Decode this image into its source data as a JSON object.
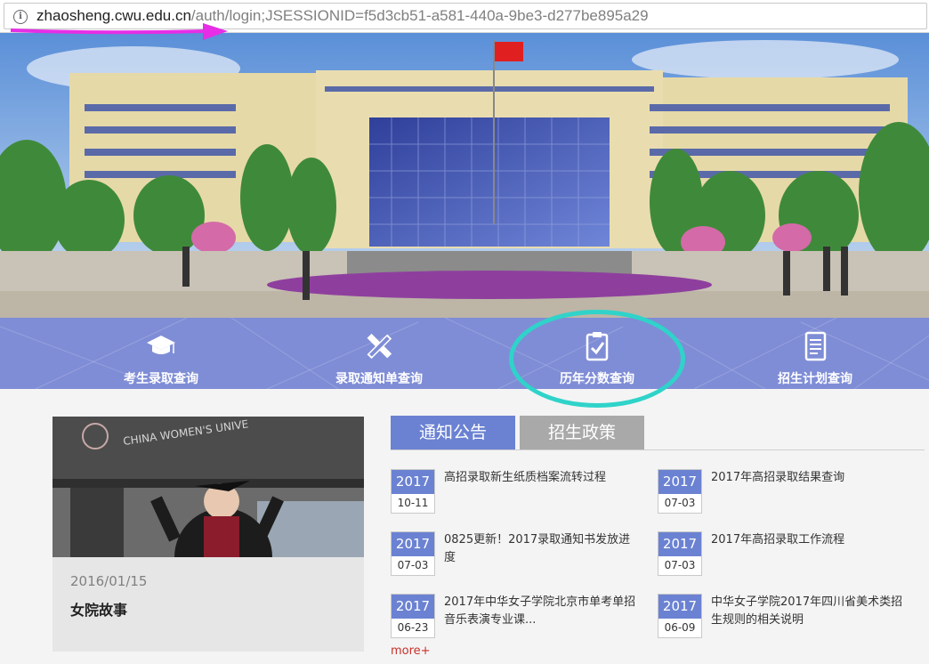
{
  "address_bar": {
    "host": "zhaosheng.cwu.edu.cn",
    "path": "/auth/login;JSESSIONID=f5d3cb51-a581-440a-9be3-d277be895a29",
    "info_icon": "info-icon"
  },
  "nav": {
    "items": [
      {
        "label": "考生录取查询",
        "icon": "graduation-cap-icon"
      },
      {
        "label": "录取通知单查询",
        "icon": "pencil-ruler-icon"
      },
      {
        "label": "历年分数查询",
        "icon": "clipboard-check-icon"
      },
      {
        "label": "招生计划查询",
        "icon": "document-icon"
      }
    ]
  },
  "feature": {
    "date": "2016/01/15",
    "title": "女院故事",
    "sign_text": "CHINA WOMEN'S UNIVE"
  },
  "tabs": {
    "active": "通知公告",
    "inactive": "招生政策"
  },
  "news": [
    {
      "year": "2017",
      "md": "10-11",
      "text": "高招录取新生纸质档案流转过程"
    },
    {
      "year": "2017",
      "md": "07-03",
      "text": "2017年高招录取结果查询"
    },
    {
      "year": "2017",
      "md": "07-03",
      "text": "0825更新！2017录取通知书发放进度"
    },
    {
      "year": "2017",
      "md": "07-03",
      "text": "2017年高招录取工作流程"
    },
    {
      "year": "2017",
      "md": "06-23",
      "text": "2017年中华女子学院北京市单考单招音乐表演专业课..."
    },
    {
      "year": "2017",
      "md": "06-09",
      "text": "中华女子学院2017年四川省美术类招生规则的相关说明"
    }
  ],
  "more_label": "more+",
  "colors": {
    "accent": "#6b82d2",
    "nav_bg": "#7f8dd6",
    "highlight_circle": "#2fd3c9",
    "annotation_arrow": "#e62ee6",
    "more_link": "#c8312a"
  }
}
